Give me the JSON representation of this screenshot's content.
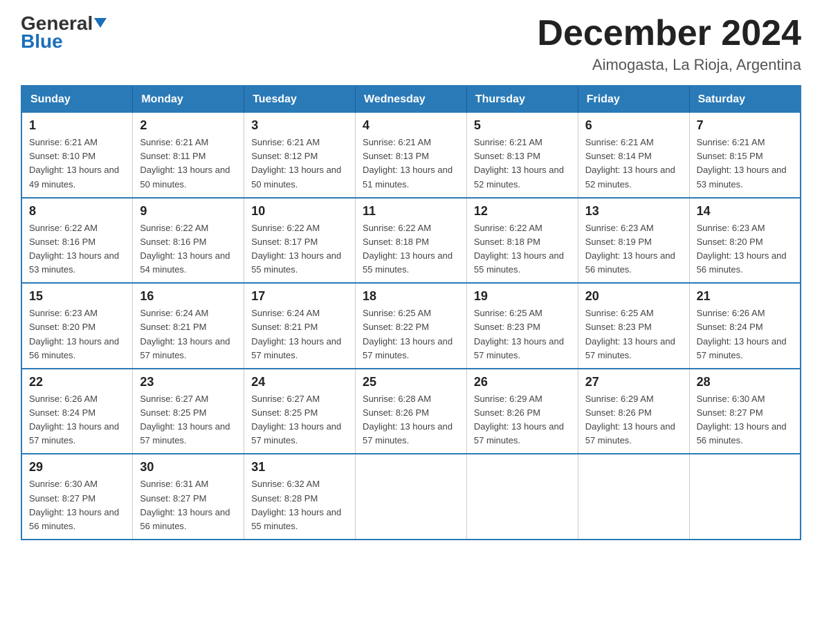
{
  "logo": {
    "general": "General",
    "blue": "Blue",
    "triangle": "▼"
  },
  "header": {
    "title": "December 2024",
    "subtitle": "Aimogasta, La Rioja, Argentina"
  },
  "days_of_week": [
    "Sunday",
    "Monday",
    "Tuesday",
    "Wednesday",
    "Thursday",
    "Friday",
    "Saturday"
  ],
  "weeks": [
    [
      {
        "day": "1",
        "sunrise": "6:21 AM",
        "sunset": "8:10 PM",
        "daylight": "13 hours and 49 minutes."
      },
      {
        "day": "2",
        "sunrise": "6:21 AM",
        "sunset": "8:11 PM",
        "daylight": "13 hours and 50 minutes."
      },
      {
        "day": "3",
        "sunrise": "6:21 AM",
        "sunset": "8:12 PM",
        "daylight": "13 hours and 50 minutes."
      },
      {
        "day": "4",
        "sunrise": "6:21 AM",
        "sunset": "8:13 PM",
        "daylight": "13 hours and 51 minutes."
      },
      {
        "day": "5",
        "sunrise": "6:21 AM",
        "sunset": "8:13 PM",
        "daylight": "13 hours and 52 minutes."
      },
      {
        "day": "6",
        "sunrise": "6:21 AM",
        "sunset": "8:14 PM",
        "daylight": "13 hours and 52 minutes."
      },
      {
        "day": "7",
        "sunrise": "6:21 AM",
        "sunset": "8:15 PM",
        "daylight": "13 hours and 53 minutes."
      }
    ],
    [
      {
        "day": "8",
        "sunrise": "6:22 AM",
        "sunset": "8:16 PM",
        "daylight": "13 hours and 53 minutes."
      },
      {
        "day": "9",
        "sunrise": "6:22 AM",
        "sunset": "8:16 PM",
        "daylight": "13 hours and 54 minutes."
      },
      {
        "day": "10",
        "sunrise": "6:22 AM",
        "sunset": "8:17 PM",
        "daylight": "13 hours and 55 minutes."
      },
      {
        "day": "11",
        "sunrise": "6:22 AM",
        "sunset": "8:18 PM",
        "daylight": "13 hours and 55 minutes."
      },
      {
        "day": "12",
        "sunrise": "6:22 AM",
        "sunset": "8:18 PM",
        "daylight": "13 hours and 55 minutes."
      },
      {
        "day": "13",
        "sunrise": "6:23 AM",
        "sunset": "8:19 PM",
        "daylight": "13 hours and 56 minutes."
      },
      {
        "day": "14",
        "sunrise": "6:23 AM",
        "sunset": "8:20 PM",
        "daylight": "13 hours and 56 minutes."
      }
    ],
    [
      {
        "day": "15",
        "sunrise": "6:23 AM",
        "sunset": "8:20 PM",
        "daylight": "13 hours and 56 minutes."
      },
      {
        "day": "16",
        "sunrise": "6:24 AM",
        "sunset": "8:21 PM",
        "daylight": "13 hours and 57 minutes."
      },
      {
        "day": "17",
        "sunrise": "6:24 AM",
        "sunset": "8:21 PM",
        "daylight": "13 hours and 57 minutes."
      },
      {
        "day": "18",
        "sunrise": "6:25 AM",
        "sunset": "8:22 PM",
        "daylight": "13 hours and 57 minutes."
      },
      {
        "day": "19",
        "sunrise": "6:25 AM",
        "sunset": "8:23 PM",
        "daylight": "13 hours and 57 minutes."
      },
      {
        "day": "20",
        "sunrise": "6:25 AM",
        "sunset": "8:23 PM",
        "daylight": "13 hours and 57 minutes."
      },
      {
        "day": "21",
        "sunrise": "6:26 AM",
        "sunset": "8:24 PM",
        "daylight": "13 hours and 57 minutes."
      }
    ],
    [
      {
        "day": "22",
        "sunrise": "6:26 AM",
        "sunset": "8:24 PM",
        "daylight": "13 hours and 57 minutes."
      },
      {
        "day": "23",
        "sunrise": "6:27 AM",
        "sunset": "8:25 PM",
        "daylight": "13 hours and 57 minutes."
      },
      {
        "day": "24",
        "sunrise": "6:27 AM",
        "sunset": "8:25 PM",
        "daylight": "13 hours and 57 minutes."
      },
      {
        "day": "25",
        "sunrise": "6:28 AM",
        "sunset": "8:26 PM",
        "daylight": "13 hours and 57 minutes."
      },
      {
        "day": "26",
        "sunrise": "6:29 AM",
        "sunset": "8:26 PM",
        "daylight": "13 hours and 57 minutes."
      },
      {
        "day": "27",
        "sunrise": "6:29 AM",
        "sunset": "8:26 PM",
        "daylight": "13 hours and 57 minutes."
      },
      {
        "day": "28",
        "sunrise": "6:30 AM",
        "sunset": "8:27 PM",
        "daylight": "13 hours and 56 minutes."
      }
    ],
    [
      {
        "day": "29",
        "sunrise": "6:30 AM",
        "sunset": "8:27 PM",
        "daylight": "13 hours and 56 minutes."
      },
      {
        "day": "30",
        "sunrise": "6:31 AM",
        "sunset": "8:27 PM",
        "daylight": "13 hours and 56 minutes."
      },
      {
        "day": "31",
        "sunrise": "6:32 AM",
        "sunset": "8:28 PM",
        "daylight": "13 hours and 55 minutes."
      },
      null,
      null,
      null,
      null
    ]
  ]
}
